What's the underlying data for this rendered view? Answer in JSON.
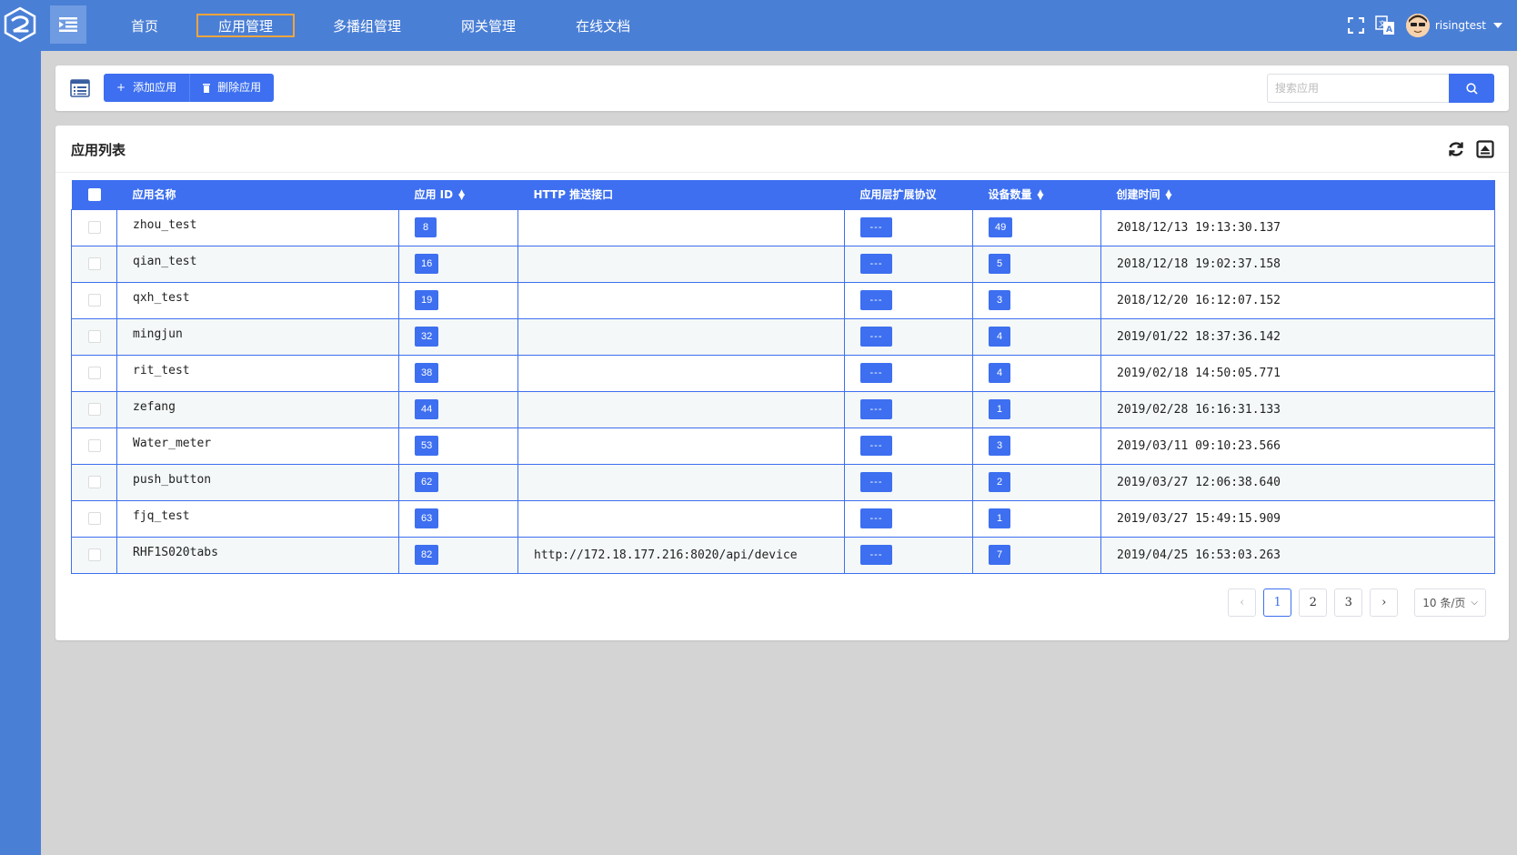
{
  "nav": {
    "items": [
      {
        "label": "首页"
      },
      {
        "label": "应用管理"
      },
      {
        "label": "多播组管理"
      },
      {
        "label": "网关管理"
      },
      {
        "label": "在线文档"
      }
    ],
    "active_index": 1
  },
  "user": {
    "name": "risingtest"
  },
  "toolbar": {
    "add_label": "添加应用",
    "delete_label": "删除应用",
    "search_placeholder": "搜索应用"
  },
  "card": {
    "title": "应用列表"
  },
  "table": {
    "headers": {
      "name": "应用名称",
      "id": "应用 ID",
      "http": "HTTP 推送接口",
      "protocol": "应用层扩展协议",
      "devices": "设备数量",
      "created": "创建时间"
    },
    "rows": [
      {
        "name": "zhou_test",
        "id": "8",
        "http": "",
        "protocol": "---",
        "devices": "49",
        "created": "2018/12/13 19:13:30.137"
      },
      {
        "name": "qian_test",
        "id": "16",
        "http": "",
        "protocol": "---",
        "devices": "5",
        "created": "2018/12/18 19:02:37.158"
      },
      {
        "name": "qxh_test",
        "id": "19",
        "http": "",
        "protocol": "---",
        "devices": "3",
        "created": "2018/12/20 16:12:07.152"
      },
      {
        "name": "mingjun",
        "id": "32",
        "http": "",
        "protocol": "---",
        "devices": "4",
        "created": "2019/01/22 18:37:36.142"
      },
      {
        "name": "rit_test",
        "id": "38",
        "http": "",
        "protocol": "---",
        "devices": "4",
        "created": "2019/02/18 14:50:05.771"
      },
      {
        "name": "zefang",
        "id": "44",
        "http": "",
        "protocol": "---",
        "devices": "1",
        "created": "2019/02/28 16:16:31.133"
      },
      {
        "name": "Water_meter",
        "id": "53",
        "http": "",
        "protocol": "---",
        "devices": "3",
        "created": "2019/03/11 09:10:23.566"
      },
      {
        "name": "push_button",
        "id": "62",
        "http": "",
        "protocol": "---",
        "devices": "2",
        "created": "2019/03/27 12:06:38.640"
      },
      {
        "name": "fjq_test",
        "id": "63",
        "http": "",
        "protocol": "---",
        "devices": "1",
        "created": "2019/03/27 15:49:15.909"
      },
      {
        "name": "RHF1S020tabs",
        "id": "82",
        "http": "http://172.18.177.216:8020/api/device",
        "protocol": "---",
        "devices": "7",
        "created": "2019/04/25 16:53:03.263"
      }
    ]
  },
  "pagination": {
    "pages": [
      "1",
      "2",
      "3"
    ],
    "current": "1",
    "page_size": "10 条/页"
  },
  "colors": {
    "brand": "#4a7fd6",
    "accent": "#3d6ff0",
    "nav_active_border": "#f0a53b"
  }
}
